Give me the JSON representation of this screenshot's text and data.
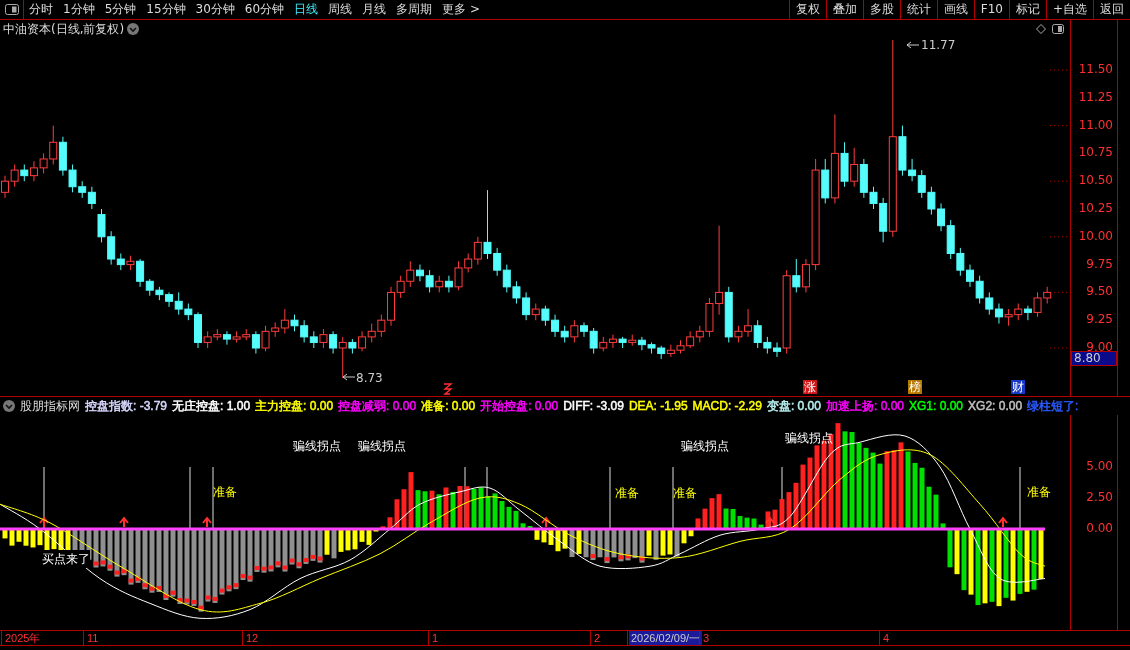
{
  "toolbar": {
    "periods": [
      {
        "label": "分时",
        "selected": false
      },
      {
        "label": "1分钟",
        "selected": false
      },
      {
        "label": "5分钟",
        "selected": false
      },
      {
        "label": "15分钟",
        "selected": false
      },
      {
        "label": "30分钟",
        "selected": false
      },
      {
        "label": "60分钟",
        "selected": false
      },
      {
        "label": "日线",
        "selected": true
      },
      {
        "label": "周线",
        "selected": false
      },
      {
        "label": "月线",
        "selected": false
      },
      {
        "label": "多周期",
        "selected": false
      },
      {
        "label": "更多 >",
        "selected": false
      }
    ],
    "actions": [
      "复权",
      "叠加",
      "多股",
      "统计",
      "画线",
      "F10",
      "标记",
      "+自选",
      "返回"
    ]
  },
  "chart_title": "中油资本(日线,前复权)",
  "price_chart": {
    "chart_data": {
      "type": "candlestick",
      "ohlc": [
        [
          10.4,
          10.55,
          10.35,
          10.5
        ],
        [
          10.5,
          10.65,
          10.45,
          10.6
        ],
        [
          10.6,
          10.65,
          10.5,
          10.55
        ],
        [
          10.55,
          10.68,
          10.5,
          10.62
        ],
        [
          10.62,
          10.75,
          10.57,
          10.7
        ],
        [
          10.7,
          11.0,
          10.65,
          10.85
        ],
        [
          10.85,
          10.9,
          10.55,
          10.6
        ],
        [
          10.6,
          10.65,
          10.4,
          10.45
        ],
        [
          10.45,
          10.5,
          10.35,
          10.4
        ],
        [
          10.4,
          10.45,
          10.25,
          10.3
        ],
        [
          10.2,
          10.25,
          9.95,
          10.0
        ],
        [
          10.0,
          10.05,
          9.75,
          9.8
        ],
        [
          9.8,
          9.85,
          9.7,
          9.75
        ],
        [
          9.75,
          9.83,
          9.7,
          9.78
        ],
        [
          9.78,
          9.8,
          9.55,
          9.6
        ],
        [
          9.6,
          9.62,
          9.47,
          9.52
        ],
        [
          9.52,
          9.55,
          9.43,
          9.48
        ],
        [
          9.48,
          9.5,
          9.37,
          9.42
        ],
        [
          9.42,
          9.5,
          9.3,
          9.35
        ],
        [
          9.35,
          9.4,
          9.25,
          9.3
        ],
        [
          9.3,
          9.32,
          9.0,
          9.05
        ],
        [
          9.05,
          9.15,
          9.0,
          9.1
        ],
        [
          9.1,
          9.17,
          9.07,
          9.12
        ],
        [
          9.12,
          9.15,
          9.03,
          9.08
        ],
        [
          9.08,
          9.15,
          9.05,
          9.1
        ],
        [
          9.1,
          9.17,
          9.07,
          9.12
        ],
        [
          9.12,
          9.15,
          8.95,
          9.0
        ],
        [
          9.0,
          9.2,
          8.97,
          9.15
        ],
        [
          9.15,
          9.23,
          9.1,
          9.18
        ],
        [
          9.18,
          9.35,
          9.13,
          9.25
        ],
        [
          9.25,
          9.3,
          9.15,
          9.2
        ],
        [
          9.2,
          9.25,
          9.05,
          9.1
        ],
        [
          9.1,
          9.15,
          9.0,
          9.05
        ],
        [
          9.05,
          9.17,
          9.0,
          9.12
        ],
        [
          9.12,
          9.15,
          8.95,
          9.0
        ],
        [
          9.0,
          9.1,
          8.73,
          9.05
        ],
        [
          9.05,
          9.08,
          8.95,
          9.0
        ],
        [
          9.0,
          9.15,
          8.97,
          9.1
        ],
        [
          9.1,
          9.22,
          9.05,
          9.15
        ],
        [
          9.15,
          9.3,
          9.1,
          9.25
        ],
        [
          9.25,
          9.55,
          9.2,
          9.5
        ],
        [
          9.5,
          9.65,
          9.45,
          9.6
        ],
        [
          9.6,
          9.78,
          9.55,
          9.7
        ],
        [
          9.7,
          9.75,
          9.6,
          9.65
        ],
        [
          9.65,
          9.7,
          9.5,
          9.55
        ],
        [
          9.55,
          9.65,
          9.5,
          9.6
        ],
        [
          9.6,
          9.65,
          9.5,
          9.55
        ],
        [
          9.55,
          9.78,
          9.52,
          9.72
        ],
        [
          9.72,
          9.85,
          9.68,
          9.8
        ],
        [
          9.8,
          10.0,
          9.75,
          9.95
        ],
        [
          9.95,
          10.42,
          9.8,
          9.85
        ],
        [
          9.85,
          9.9,
          9.65,
          9.7
        ],
        [
          9.7,
          9.75,
          9.5,
          9.55
        ],
        [
          9.55,
          9.6,
          9.4,
          9.45
        ],
        [
          9.45,
          9.5,
          9.25,
          9.3
        ],
        [
          9.3,
          9.4,
          9.25,
          9.35
        ],
        [
          9.35,
          9.38,
          9.2,
          9.25
        ],
        [
          9.25,
          9.3,
          9.1,
          9.15
        ],
        [
          9.15,
          9.2,
          9.05,
          9.1
        ],
        [
          9.1,
          9.25,
          9.05,
          9.2
        ],
        [
          9.2,
          9.23,
          9.1,
          9.15
        ],
        [
          9.15,
          9.18,
          8.95,
          9.0
        ],
        [
          9.0,
          9.1,
          8.97,
          9.05
        ],
        [
          9.05,
          9.12,
          9.0,
          9.08
        ],
        [
          9.08,
          9.1,
          9.0,
          9.05
        ],
        [
          9.05,
          9.12,
          9.02,
          9.07
        ],
        [
          9.07,
          9.1,
          8.98,
          9.03
        ],
        [
          9.03,
          9.05,
          8.95,
          9.0
        ],
        [
          9.0,
          9.02,
          8.9,
          8.95
        ],
        [
          8.95,
          9.03,
          8.92,
          8.98
        ],
        [
          8.98,
          9.07,
          8.95,
          9.02
        ],
        [
          9.02,
          9.15,
          9.0,
          9.1
        ],
        [
          9.1,
          9.2,
          9.05,
          9.15
        ],
        [
          9.15,
          9.45,
          9.1,
          9.4
        ],
        [
          9.4,
          10.1,
          9.3,
          9.5
        ],
        [
          9.5,
          9.55,
          9.05,
          9.1
        ],
        [
          9.1,
          9.2,
          9.05,
          9.15
        ],
        [
          9.15,
          9.35,
          9.1,
          9.2
        ],
        [
          9.2,
          9.25,
          9.0,
          9.05
        ],
        [
          9.05,
          9.1,
          8.95,
          9.0
        ],
        [
          9.0,
          9.05,
          8.92,
          8.97
        ],
        [
          9.0,
          9.7,
          8.95,
          9.65
        ],
        [
          9.65,
          9.8,
          9.5,
          9.55
        ],
        [
          9.55,
          9.8,
          9.5,
          9.75
        ],
        [
          9.75,
          10.7,
          9.7,
          10.6
        ],
        [
          10.6,
          10.7,
          10.3,
          10.35
        ],
        [
          10.35,
          11.1,
          10.3,
          10.75
        ],
        [
          10.75,
          10.85,
          10.45,
          10.5
        ],
        [
          10.5,
          10.8,
          10.45,
          10.65
        ],
        [
          10.65,
          10.7,
          10.35,
          10.4
        ],
        [
          10.4,
          10.45,
          10.25,
          10.3
        ],
        [
          10.3,
          10.35,
          9.95,
          10.05
        ],
        [
          10.05,
          11.77,
          10.0,
          10.9
        ],
        [
          10.9,
          11.0,
          10.55,
          10.6
        ],
        [
          10.6,
          10.7,
          10.5,
          10.55
        ],
        [
          10.55,
          10.6,
          10.35,
          10.4
        ],
        [
          10.4,
          10.45,
          10.2,
          10.25
        ],
        [
          10.25,
          10.3,
          10.05,
          10.1
        ],
        [
          10.1,
          10.15,
          9.8,
          9.85
        ],
        [
          9.85,
          9.9,
          9.65,
          9.7
        ],
        [
          9.7,
          9.75,
          9.55,
          9.6
        ],
        [
          9.6,
          9.65,
          9.4,
          9.45
        ],
        [
          9.45,
          9.5,
          9.3,
          9.35
        ],
        [
          9.35,
          9.4,
          9.22,
          9.28
        ],
        [
          9.28,
          9.35,
          9.2,
          9.3
        ],
        [
          9.3,
          9.4,
          9.25,
          9.35
        ],
        [
          9.35,
          9.38,
          9.25,
          9.32
        ],
        [
          9.32,
          9.5,
          9.28,
          9.45
        ],
        [
          9.45,
          9.55,
          9.4,
          9.5
        ]
      ]
    }
  },
  "price_axis": {
    "ticks": [
      "11.50",
      "11.25",
      "11.00",
      "10.75",
      "10.50",
      "10.25",
      "10.00",
      "9.75",
      "9.50",
      "9.25",
      "9.00"
    ],
    "current": "8.80"
  },
  "price_labels": {
    "high": "11.77",
    "low": "8.73"
  },
  "events": [
    {
      "label": "涨",
      "color": "#d01818"
    },
    {
      "label": "榜",
      "color": "#b87800"
    },
    {
      "label": "财",
      "color": "#1838c8"
    }
  ],
  "indicator": {
    "name": "股朋指标网",
    "values": [
      {
        "text": "控盘指数: -3.79",
        "color": "#d8d8ff"
      },
      {
        "text": "无庄控盘: 1.00",
        "color": "#ffffff"
      },
      {
        "text": "主力控盘: 0.00",
        "color": "#ffff00"
      },
      {
        "text": "控盘减弱: 0.00",
        "color": "#ff00ff"
      },
      {
        "text": "准备: 0.00",
        "color": "#ffff00"
      },
      {
        "text": "开始控盘: 0.00",
        "color": "#ff00ff"
      },
      {
        "text": "DIFF: -3.09",
        "color": "#ffffff"
      },
      {
        "text": "DEA: -1.95",
        "color": "#ffff00"
      },
      {
        "text": "MACD: -2.29",
        "color": "#ffff00"
      },
      {
        "text": "变盘: 0.00",
        "color": "#b8f0f0"
      },
      {
        "text": "加速上扬: 0.00",
        "color": "#ff00ff"
      },
      {
        "text": "XG1: 0.00",
        "color": "#00ff00"
      },
      {
        "text": "XG2: 0.00",
        "color": "#c0c0c0"
      },
      {
        "text": "绿柱短了:",
        "color": "#2a5aff"
      }
    ]
  },
  "signals": [
    {
      "kind": "turn",
      "text": "骗线拐点"
    },
    {
      "kind": "turn",
      "text": "骗线拐点"
    },
    {
      "kind": "turn",
      "text": "骗线拐点"
    },
    {
      "kind": "turn",
      "text": "骗线拐点"
    },
    {
      "kind": "ready",
      "text": "准备"
    },
    {
      "kind": "ready",
      "text": "准备"
    },
    {
      "kind": "ready",
      "text": "准备"
    },
    {
      "kind": "ready",
      "text": "准备"
    },
    {
      "kind": "buy",
      "text": "买点来了"
    }
  ],
  "indicator_axis": [
    "5.00",
    "2.50",
    "0.00"
  ],
  "date_axis": [
    {
      "label": "2025年",
      "selected": false
    },
    {
      "label": "11",
      "selected": false
    },
    {
      "label": "12",
      "selected": false
    },
    {
      "label": "1",
      "selected": false
    },
    {
      "label": "2",
      "selected": false
    },
    {
      "label": "2026/02/09/一",
      "selected": true
    },
    {
      "label": "3",
      "selected": false
    },
    {
      "label": "4",
      "selected": false
    }
  ]
}
